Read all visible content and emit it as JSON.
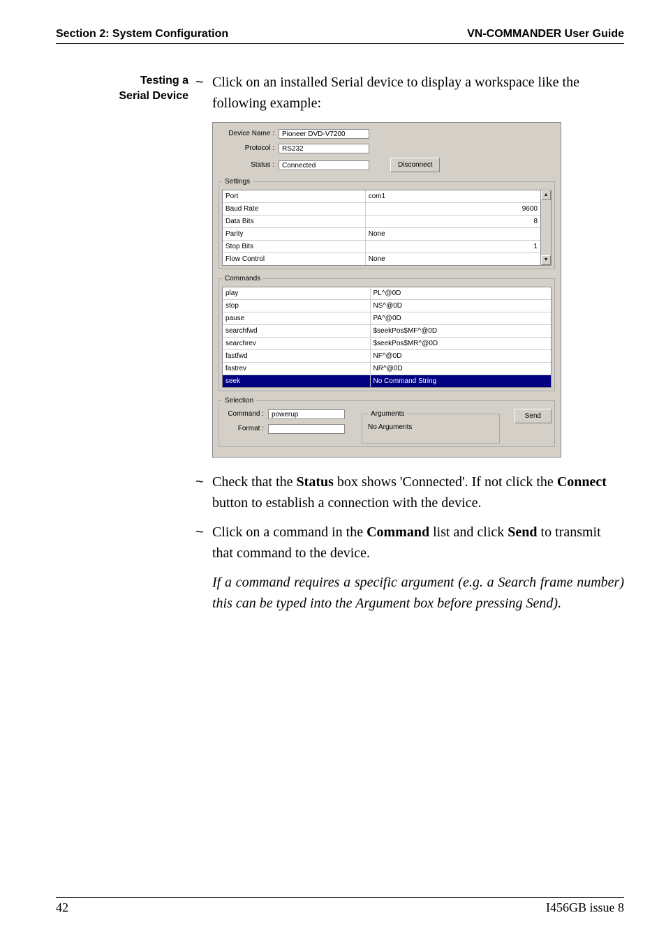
{
  "header": {
    "left": "Section 2: System Configuration",
    "right": "VN-COMMANDER User Guide"
  },
  "sidebar_label": {
    "line1": "Testing a",
    "line2": "Serial Device"
  },
  "bullets": {
    "item1": "Click on an installed Serial device to display a workspace like the following example:",
    "item2_pre": "Check that the ",
    "item2_status": "Status",
    "item2_mid": " box shows 'Connected'. If not click the ",
    "item2_connect": "Connect",
    "item2_post": " button to establish a connection with the device.",
    "item3_pre": "Click on a command in the ",
    "item3_cmd": "Command",
    "item3_mid": " list and click ",
    "item3_send": "Send",
    "item3_post": " to transmit that command to the device."
  },
  "note": "If a command requires a specific argument (e.g. a Search frame number) this can be typed into the Argument box before pressing Send).",
  "screenshot": {
    "labels": {
      "device_name": "Device Name :",
      "protocol": "Protocol :",
      "status": "Status :",
      "disconnect": "Disconnect",
      "settings": "Settings",
      "commands": "Commands",
      "selection": "Selection",
      "command": "Command :",
      "format": "Format :",
      "arguments": "Arguments",
      "no_arguments": "No Arguments",
      "send": "Send"
    },
    "fields": {
      "device_name": "Pioneer DVD-V7200",
      "protocol": "RS232",
      "status": "Connected",
      "command": "powerup",
      "format": ""
    },
    "settings_rows": [
      {
        "k": "Port",
        "v": "com1",
        "align": "left"
      },
      {
        "k": "Baud Rate",
        "v": "9600",
        "align": "right"
      },
      {
        "k": "Data Bits",
        "v": "8",
        "align": "right"
      },
      {
        "k": "Parity",
        "v": "None",
        "align": "left"
      },
      {
        "k": "Stop Bits",
        "v": "1",
        "align": "right"
      },
      {
        "k": "Flow Control",
        "v": "None",
        "align": "left"
      }
    ],
    "commands_rows": [
      {
        "k": "play",
        "v": "PL^@0D",
        "sel": false
      },
      {
        "k": "stop",
        "v": "NS^@0D",
        "sel": false
      },
      {
        "k": "pause",
        "v": "PA^@0D",
        "sel": false
      },
      {
        "k": "searchfwd",
        "v": "$seekPos$MF^@0D",
        "sel": false
      },
      {
        "k": "searchrev",
        "v": "$seekPos$MR^@0D",
        "sel": false
      },
      {
        "k": "fastfwd",
        "v": "NF^@0D",
        "sel": false
      },
      {
        "k": "fastrev",
        "v": "NR^@0D",
        "sel": false
      },
      {
        "k": "seek",
        "v": "No Command String",
        "sel": true
      }
    ]
  },
  "footer": {
    "page": "42",
    "issue": "I456GB issue 8"
  }
}
